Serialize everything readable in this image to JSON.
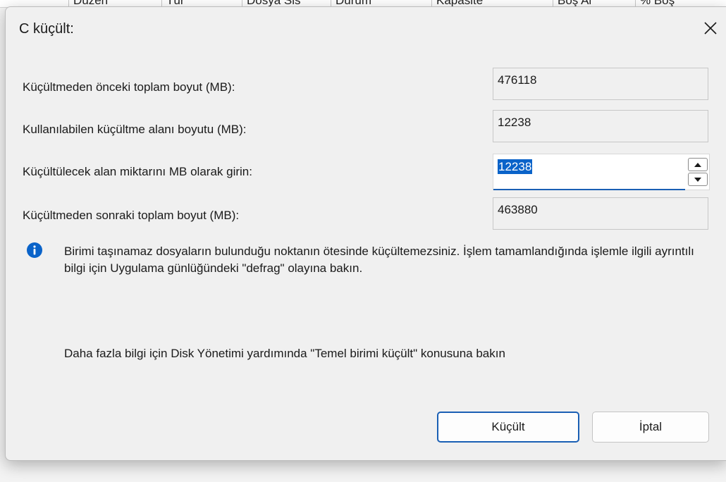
{
  "background": {
    "columns": [
      "Düzen",
      "Tür",
      "Dosya Sis",
      "Durum",
      "Kapasite",
      "Boş Al",
      "% Boş"
    ]
  },
  "dialog": {
    "title": "C küçült:",
    "close_icon": "close-icon",
    "rows": [
      {
        "label": "Küçültmeden önceki toplam boyut (MB):",
        "value": "476118"
      },
      {
        "label": "Kullanılabilen küçültme alanı boyutu (MB):",
        "value": "12238"
      },
      {
        "label": "Küçültülecek alan miktarını MB olarak girin:",
        "value": "12238"
      },
      {
        "label": "Küçültmeden sonraki toplam boyut (MB):",
        "value": "463880"
      }
    ],
    "info_icon": "info-icon",
    "info_text": "Birimi taşınamaz dosyaların bulunduğu noktanın ötesinde küçültemezsiniz. İşlem tamamlandığında işlemle ilgili ayrıntılı bilgi için Uygulama günlüğündeki \"defrag\" olayına bakın.",
    "help_text": "Daha fazla bilgi için Disk Yönetimi yardımında \"Temel birimi küçült\" konusuna bakın",
    "buttons": {
      "shrink": "Küçült",
      "cancel": "İptal"
    },
    "colors": {
      "accent": "#1a5fb4",
      "selection": "#0a63c9",
      "info": "#0a63c9"
    }
  }
}
